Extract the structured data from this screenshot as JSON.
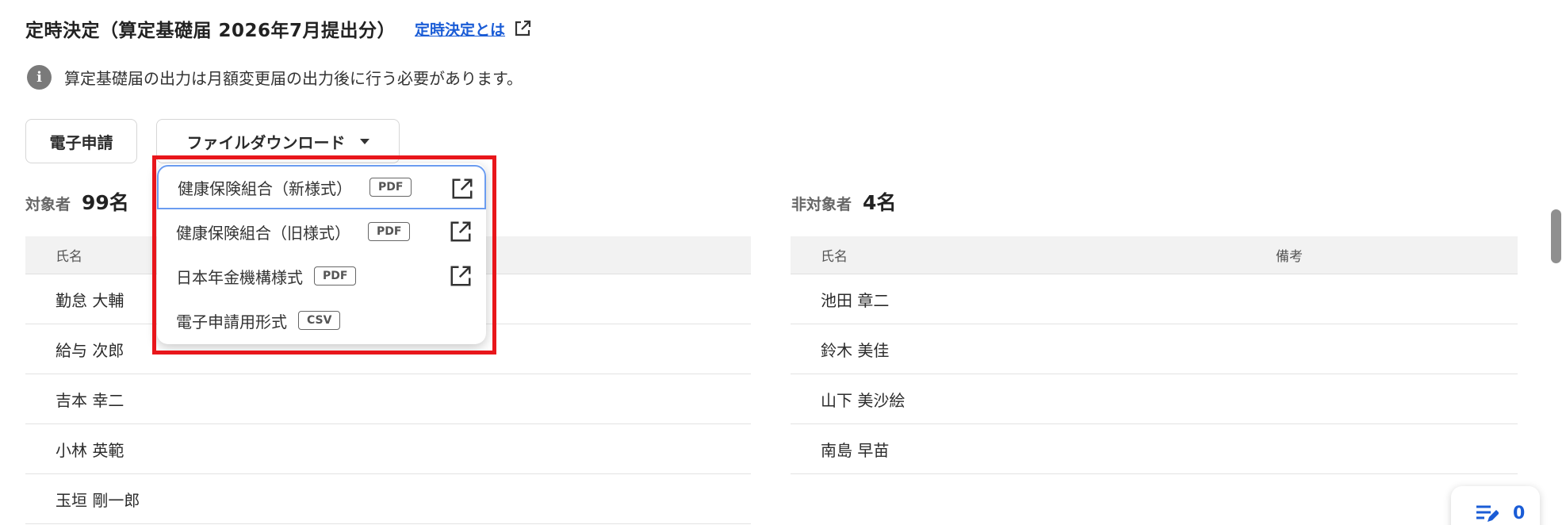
{
  "header": {
    "title": "定時決定（算定基礎届 2026年7月提出分）",
    "help_link": "定時決定とは"
  },
  "notice": {
    "text": "算定基礎届の出力は月額変更届の出力後に行う必要があります。"
  },
  "toolbar": {
    "e_application_label": "電子申請",
    "download_label": "ファイルダウンロード"
  },
  "download_menu": {
    "items": [
      {
        "label": "健康保険組合（新様式）",
        "tag": "PDF"
      },
      {
        "label": "健康保険組合（旧様式）",
        "tag": "PDF"
      },
      {
        "label": "日本年金機構様式",
        "tag": "PDF"
      },
      {
        "label": "電子申請用形式",
        "tag": "CSV"
      }
    ]
  },
  "target": {
    "label": "対象者",
    "count": "99名",
    "column_name": "氏名",
    "rows": [
      "勤怠 大輔",
      "給与 次郎",
      "吉本 幸二",
      "小林 英範",
      "玉垣 剛一郎"
    ]
  },
  "non_target": {
    "label": "非対象者",
    "count": "4名",
    "column_name": "氏名",
    "column_note": "備考",
    "rows": [
      "池田 章二",
      "鈴木 美佳",
      "山下 美沙絵",
      "南島 早苗"
    ]
  },
  "fab": {
    "count": "0"
  }
}
